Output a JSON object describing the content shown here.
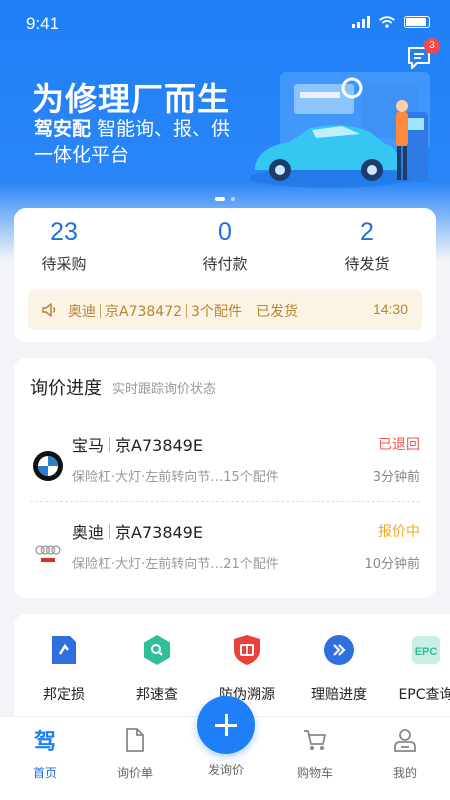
{
  "status_bar": {
    "time": "9:41"
  },
  "header": {
    "message_badge": "3"
  },
  "banner": {
    "headline": "为修理厂而生",
    "brand": "驾安配",
    "tagline_part1": "智能询、报、供",
    "tagline_part2": "一体化平台",
    "slides": 2,
    "active_slide": 1
  },
  "stats": [
    {
      "value": "23",
      "label": "待采购"
    },
    {
      "value": "0",
      "label": "待付款"
    },
    {
      "value": "2",
      "label": "待发货"
    }
  ],
  "notice": {
    "brand": "奥迪",
    "plate": "京A738472",
    "parts": "3个配件",
    "state": "已发货",
    "time": "14:30"
  },
  "inquiry": {
    "title": "询价进度",
    "subtitle": "实时跟踪询价状态",
    "items": [
      {
        "brand": "宝马",
        "plate": "京A73849E",
        "status": "已退回",
        "status_color": "#f0584f",
        "parts": "保险杠·大灯·左前转向节…15个配件",
        "ago": "3分钟前",
        "logo": "bmw-logo"
      },
      {
        "brand": "奥迪",
        "plate": "京A73849E",
        "status": "报价中",
        "status_color": "#f5a623",
        "parts": "保险杠·大灯·左前转向节…21个配件",
        "ago": "10分钟前",
        "logo": "audi-logo"
      }
    ]
  },
  "tools": [
    {
      "label": "邦定损",
      "icon": "document-icon",
      "color": "#2f6fe0"
    },
    {
      "label": "邦速查",
      "icon": "search-hexagon-icon",
      "color": "#2fbf9a"
    },
    {
      "label": "防伪溯源",
      "icon": "shield-icon",
      "color": "#e8423a"
    },
    {
      "label": "理赔进度",
      "icon": "forward-icon",
      "color": "#2f6fe0"
    },
    {
      "label": "EPC查询",
      "icon": "epc-icon",
      "badge": "EPC",
      "color": "#2fbf9a"
    }
  ],
  "tabbar": {
    "items": [
      {
        "label": "首页",
        "icon": "home-icon",
        "glyph": "驾",
        "active": true
      },
      {
        "label": "询价单",
        "icon": "inquiry-list-icon"
      },
      {
        "label": "发询价",
        "icon": "add-icon"
      },
      {
        "label": "购物车",
        "icon": "cart-icon"
      },
      {
        "label": "我的",
        "icon": "profile-icon"
      }
    ]
  },
  "colors": {
    "primary": "#1f7ff7",
    "accent_blue": "#1f6fdc",
    "notice_bg": "#fbf3e4",
    "notice_text": "#b68535"
  }
}
